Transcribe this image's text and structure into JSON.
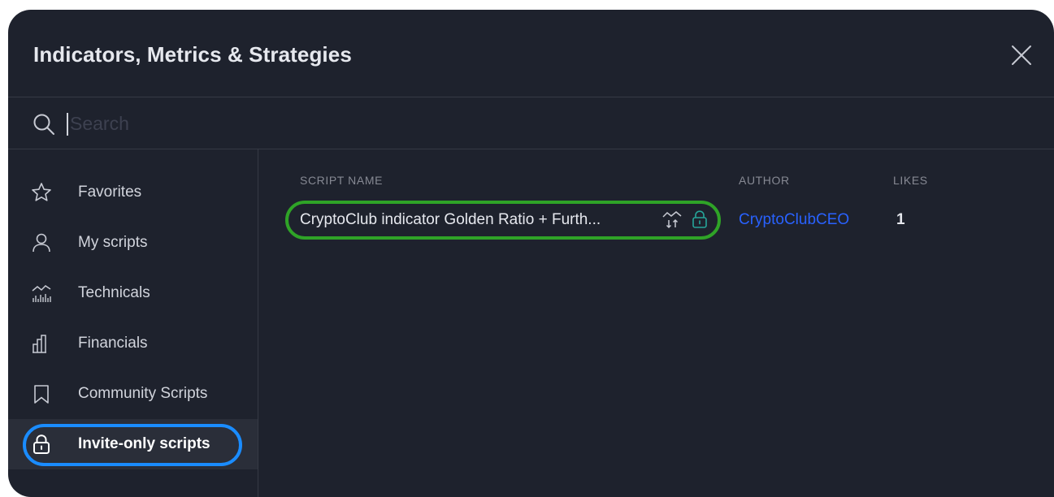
{
  "dialog": {
    "title": "Indicators, Metrics & Strategies",
    "close_icon": "close-icon"
  },
  "search": {
    "placeholder": "Search",
    "value": "",
    "icon": "search-icon"
  },
  "sidebar": {
    "items": [
      {
        "label": "Favorites",
        "icon": "star-icon",
        "active": false
      },
      {
        "label": "My scripts",
        "icon": "user-icon",
        "active": false
      },
      {
        "label": "Technicals",
        "icon": "technicals-chart-icon",
        "active": false
      },
      {
        "label": "Financials",
        "icon": "bar-chart-icon",
        "active": false
      },
      {
        "label": "Community Scripts",
        "icon": "bookmark-icon",
        "active": false
      },
      {
        "label": "Invite-only scripts",
        "icon": "lock-icon",
        "active": true
      }
    ]
  },
  "table": {
    "columns": {
      "script_name": "SCRIPT NAME",
      "author": "AUTHOR",
      "likes": "LIKES"
    },
    "rows": [
      {
        "script_name": "CryptoClub indicator Golden Ratio + Furth...",
        "author": "CryptoClubCEO",
        "likes": "1",
        "icons": [
          "strategy-icon",
          "lock-icon"
        ]
      }
    ]
  },
  "colors": {
    "background": "#1e222d",
    "active_item": "#2a2e39",
    "author_link": "#2962ff",
    "lock_accent": "#26a69a",
    "highlight_blue": "#1a8cff",
    "highlight_green": "#2fa327"
  }
}
